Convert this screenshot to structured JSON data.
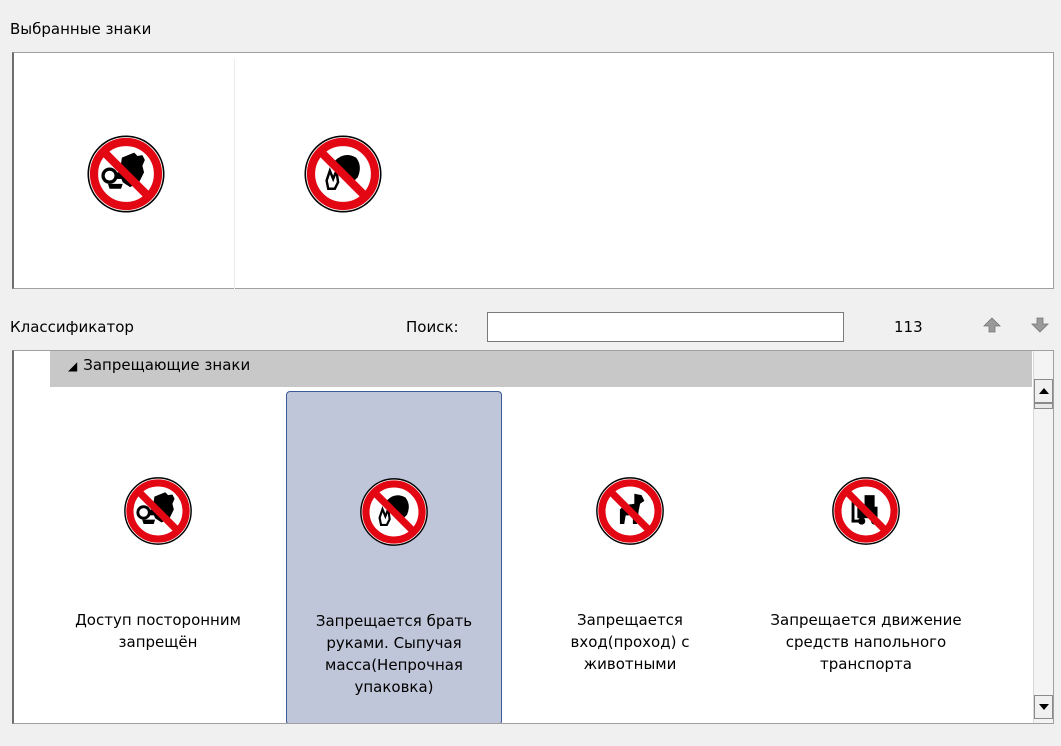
{
  "selected": {
    "title": "Выбранные знаки",
    "items": [
      {
        "icon": "no-entry-hand-icon"
      },
      {
        "icon": "no-hands-grab-icon"
      }
    ]
  },
  "classifier": {
    "label": "Классификатор",
    "search_label": "Поиск:",
    "search_value": "",
    "count": "113",
    "group": {
      "title": "Запрещающие знаки",
      "items": [
        {
          "caption": "Доступ посторонним запрещён",
          "icon": "no-entry-hand-icon",
          "selected": false
        },
        {
          "caption": "Запрещается брать руками. Сыпучая масса(Непрочная упаковка)",
          "icon": "no-hands-grab-icon",
          "selected": true
        },
        {
          "caption": "Запрещается вход(проход) с животными",
          "icon": "no-animals-icon",
          "selected": false
        },
        {
          "caption": "Запрещается движение средств напольного транспорта",
          "icon": "no-forklift-icon",
          "selected": false
        }
      ]
    }
  },
  "colors": {
    "sign_red": "#e30613",
    "selection_bg": "#c0c6d9",
    "selection_border": "#3b5a9a",
    "group_header_bg": "#c8c8c8"
  }
}
